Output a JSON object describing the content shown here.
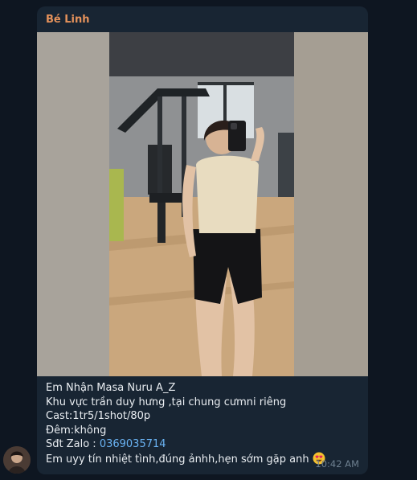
{
  "message": {
    "sender": "Bé Linh",
    "lines": [
      "Em Nhận Masa Nuru A_Z",
      "Khu vực trần duy hưng ,tại chung cưmni riêng",
      "Cast:1tr5/1shot/80p",
      "Đêm:không"
    ],
    "phone_label": "Sđt Zalo : ",
    "phone_number": "0369035714",
    "last_line": "Em uyy tín nhiệt tình,đúng ảnhh,hẹn sớm gặp anh",
    "emoji_icon": "heart-eyes-emoji",
    "time": "10:42 AM"
  },
  "colors": {
    "background": "#0e1621",
    "bubble": "#182533",
    "sender_name": "#e5925b",
    "text": "#e9edf1",
    "link": "#6ab3f3",
    "time": "#6d7f8f"
  }
}
